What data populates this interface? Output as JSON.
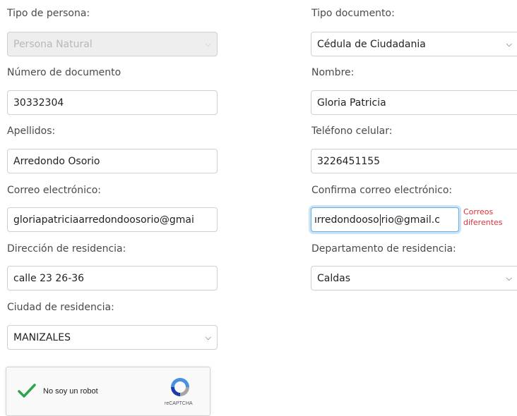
{
  "form": {
    "tipo_persona": {
      "label": "Tipo de persona:",
      "value": "Persona Natural"
    },
    "tipo_documento": {
      "label": "Tipo documento:",
      "value": "Cédula de Ciudadania"
    },
    "numero_documento": {
      "label": "Número de documento",
      "value": "30332304"
    },
    "nombre": {
      "label": "Nombre:",
      "value": "Gloria Patricia"
    },
    "apellidos": {
      "label": "Apellidos:",
      "value": "Arredondo Osorio"
    },
    "telefono": {
      "label": "Teléfono celular:",
      "value": "3226451155"
    },
    "correo": {
      "label": "Correo electrónico:",
      "value": "gloriapatriciaarredondoosorio@gmai"
    },
    "confirma_correo": {
      "label": "Confirma correo electrónico:",
      "value_before_caret": "ırredondoosо",
      "value_after_caret": "rio@gmail.c",
      "error_line1": "Correos",
      "error_line2": "diferentes"
    },
    "direccion": {
      "label": "Dirección de residencia:",
      "value": "calle 23 26-36"
    },
    "departamento": {
      "label": "Departamento de residencia:",
      "value": "Caldas"
    },
    "ciudad": {
      "label": "Ciudad de residencia:",
      "value": "MANIZALES"
    }
  },
  "captcha": {
    "text": "No soy un robot",
    "brand": "reCAPTCHA"
  },
  "icons": {
    "select_chevron": "chevron-down-icon",
    "captcha_check": "checkmark-icon",
    "captcha_logo": "recaptcha-logo-icon"
  },
  "colors": {
    "error": "#e0303a",
    "focus_border": "#66afe9",
    "check_green": "#2ea44f"
  }
}
